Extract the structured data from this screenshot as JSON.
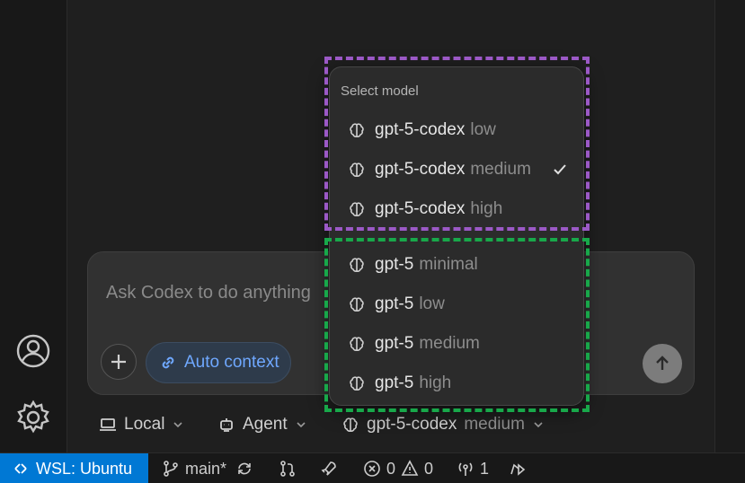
{
  "composer": {
    "placeholder": "Ask Codex to do anything",
    "auto_context_label": "Auto context"
  },
  "selectors": {
    "location_label": "Local",
    "mode_label": "Agent",
    "model_name": "gpt-5-codex",
    "model_effort": "medium"
  },
  "dropdown": {
    "title": "Select model",
    "selected_index": 1,
    "items": [
      {
        "model": "gpt-5-codex",
        "effort": "low"
      },
      {
        "model": "gpt-5-codex",
        "effort": "medium"
      },
      {
        "model": "gpt-5-codex",
        "effort": "high"
      },
      {
        "model": "gpt-5",
        "effort": "minimal"
      },
      {
        "model": "gpt-5",
        "effort": "low"
      },
      {
        "model": "gpt-5",
        "effort": "medium"
      },
      {
        "model": "gpt-5",
        "effort": "high"
      }
    ]
  },
  "statusbar": {
    "remote_label": "WSL: Ubuntu",
    "branch": "main*",
    "errors": "0",
    "warnings": "0",
    "ports": "1"
  },
  "colors": {
    "accent_blue": "#0078d4",
    "highlight_purple": "#9b59c6",
    "highlight_green": "#18a84a",
    "auto_context_text": "#6fa8ff"
  },
  "icons": {
    "activity_bar": [
      "account-icon",
      "settings-gear-icon"
    ],
    "model_item": "brain-icon",
    "selected": "checkmark-icon"
  }
}
